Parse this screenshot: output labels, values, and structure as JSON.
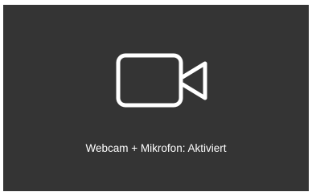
{
  "panel": {
    "icon": "video-camera-icon",
    "status_text": "Webcam + Mikrofon: Aktiviert",
    "background_color": "#343434",
    "foreground_color": "#ffffff"
  }
}
